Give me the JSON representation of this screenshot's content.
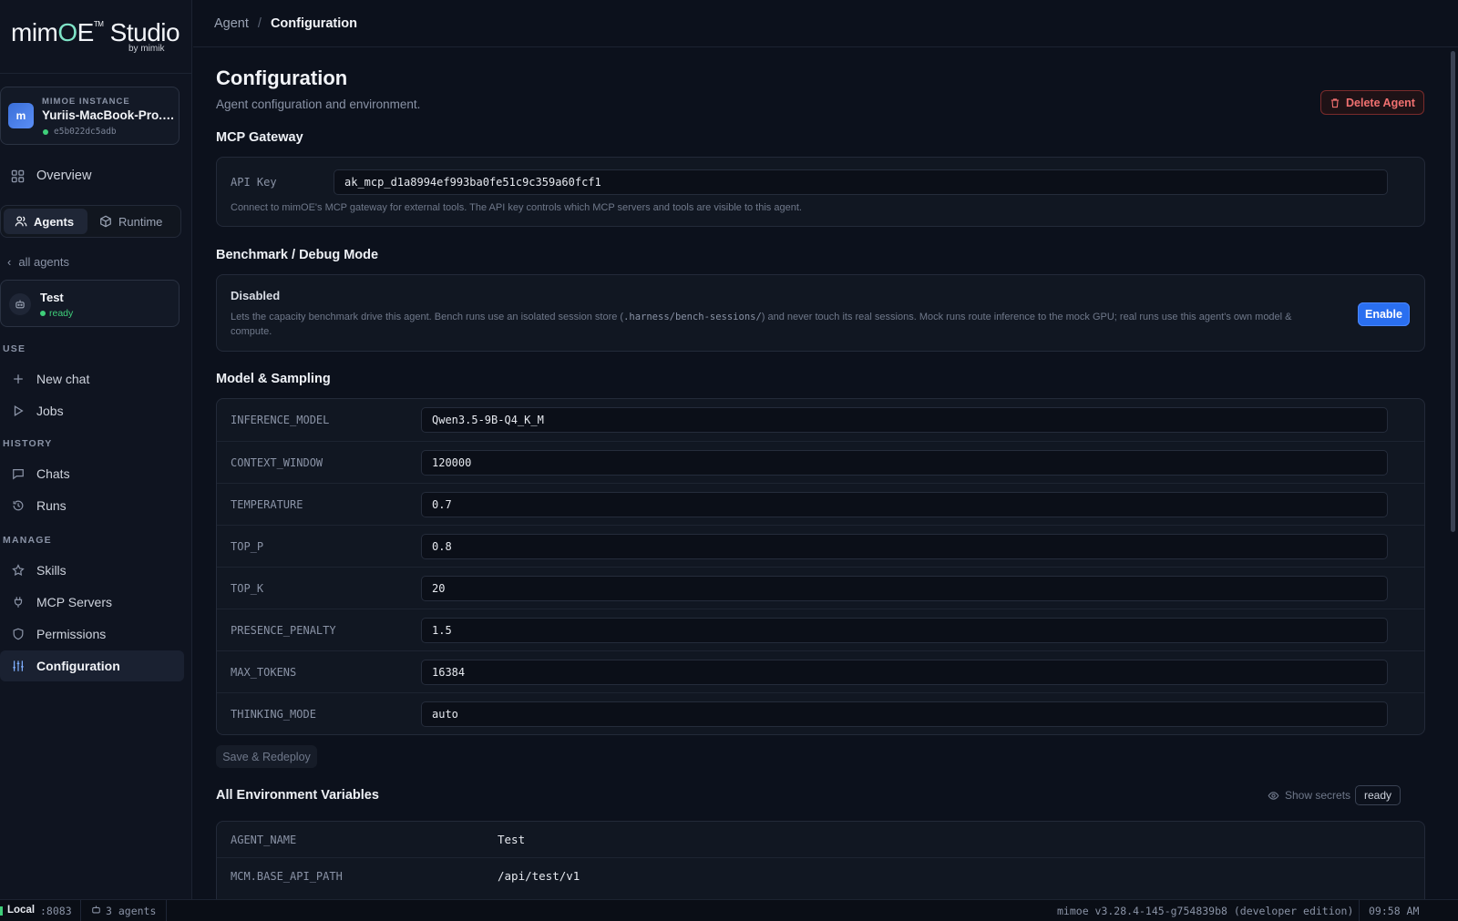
{
  "brand": {
    "name_start": "mim",
    "name_o": "O",
    "name_e": "E",
    "tm": "TM",
    "name_rest": " Studio",
    "by": "by mimik"
  },
  "instance": {
    "badge": "m",
    "kicker": "MIMOE INSTANCE",
    "name": "Yuriis-MacBook-Pro.local",
    "id": "e5b022dc5adb"
  },
  "sidebar": {
    "overview": "Overview",
    "tabs": {
      "agents": "Agents",
      "runtime": "Runtime"
    },
    "back": "all agents",
    "agent": {
      "name": "Test",
      "status": "ready"
    },
    "sections": {
      "use": {
        "title": "USE",
        "items": [
          "New chat",
          "Jobs"
        ]
      },
      "history": {
        "title": "HISTORY",
        "items": [
          "Chats",
          "Runs"
        ]
      },
      "manage": {
        "title": "MANAGE",
        "items": [
          "Skills",
          "MCP Servers",
          "Permissions",
          "Configuration"
        ]
      }
    }
  },
  "breadcrumb": {
    "parent": "Agent",
    "sep": "/",
    "current": "Configuration"
  },
  "page": {
    "title": "Configuration",
    "subtitle": "Agent configuration and environment.",
    "delete_label": "Delete Agent"
  },
  "mcp": {
    "title": "MCP Gateway",
    "api_label": "API Key",
    "api_value": "ak_mcp_d1a8994ef993ba0fe51c9c359a60fcf1",
    "hint": "Connect to mimOE's MCP gateway for external tools. The API key controls which MCP servers and tools are visible to this agent."
  },
  "bench": {
    "title": "Benchmark / Debug Mode",
    "state": "Disabled",
    "hint_a": "Lets the capacity benchmark drive this agent. Bench runs use an isolated session store (",
    "hint_code": ".harness/bench-sessions/",
    "hint_b": ") and never touch its real sessions. Mock runs route inference to the mock GPU; real runs use this agent's own model & compute.",
    "enable_label": "Enable"
  },
  "model": {
    "title": "Model & Sampling",
    "rows": [
      {
        "key": "INFERENCE_MODEL",
        "value": "Qwen3.5-9B-Q4_K_M"
      },
      {
        "key": "CONTEXT_WINDOW",
        "value": "120000"
      },
      {
        "key": "TEMPERATURE",
        "value": "0.7"
      },
      {
        "key": "TOP_P",
        "value": "0.8"
      },
      {
        "key": "TOP_K",
        "value": "20"
      },
      {
        "key": "PRESENCE_PENALTY",
        "value": "1.5"
      },
      {
        "key": "MAX_TOKENS",
        "value": "16384"
      },
      {
        "key": "THINKING_MODE",
        "value": "auto"
      }
    ],
    "save_label": "Save & Redeploy"
  },
  "env": {
    "title": "All Environment Variables",
    "show_secrets": "Show secrets",
    "status": "ready",
    "rows": [
      {
        "key": "AGENT_NAME",
        "value": "Test"
      },
      {
        "key": "MCM.BASE_API_PATH",
        "value": "/api/test/v1"
      }
    ]
  },
  "status_bar": {
    "mode": "Local",
    "port": ":8083",
    "agents": "3 agents",
    "version": "mimoe v3.28.4-145-g754839b8 (developer edition)",
    "time": "09:58 AM"
  },
  "colors": {
    "accent": "#2a6ff0",
    "danger": "#f07070",
    "ready": "#3fcf7a",
    "brand_o": "#7fe3c7"
  }
}
